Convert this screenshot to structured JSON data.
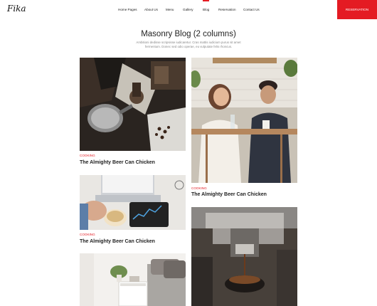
{
  "site": {
    "logo": "Fika"
  },
  "nav": [
    {
      "label": "Home Pages"
    },
    {
      "label": "About Us"
    },
    {
      "label": "Menu"
    },
    {
      "label": "Gallery"
    },
    {
      "label": "Blog"
    },
    {
      "label": "Reservation"
    },
    {
      "label": "Contact Us"
    }
  ],
  "header": {
    "reservation_label": "RESERVATION"
  },
  "hero": {
    "title": "Masonry Blog (2 columns)",
    "subtitle": "Ambitioni dedisse scripsisse iudicaretur. Cras mattis iudicium purus sit amet fermentum. Donec sed odio operae, eu vulputate felis rhoncus."
  },
  "posts": [
    {
      "category": "COOKING",
      "title": "The Almighty Beer Can Chicken"
    },
    {
      "category": "COOKING",
      "title": "The Almighty Beer Can Chicken"
    },
    {
      "category": "COOKING",
      "title": "The Almighty Beer Can Chicken"
    }
  ]
}
